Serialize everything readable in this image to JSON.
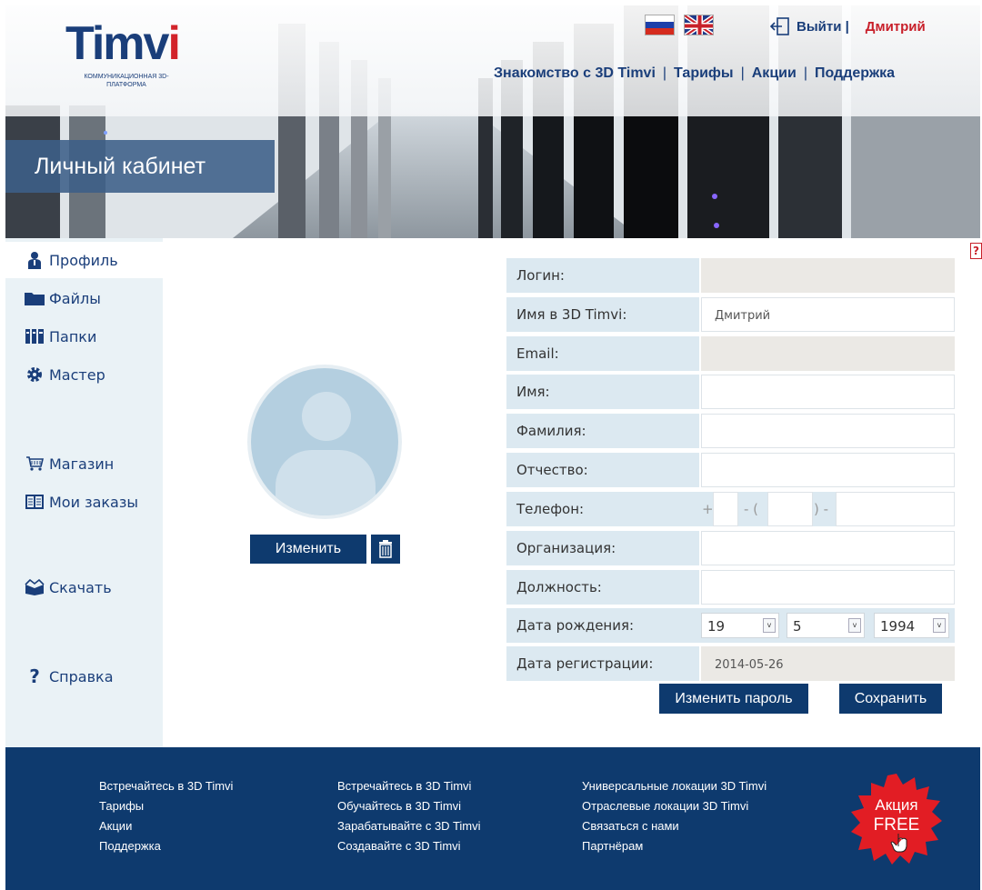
{
  "header": {
    "logo_text": "Timvi",
    "logo_subtitle": "КОММУНИКАЦИОННАЯ 3D-ПЛАТФОРМА",
    "logout_label": "Выйти |",
    "username": "Дмитрий",
    "nav": [
      {
        "label": "Знакомство с 3D Timvi"
      },
      {
        "label": "Тарифы"
      },
      {
        "label": "Акции"
      },
      {
        "label": "Поддержка"
      }
    ],
    "nav_separator": "|",
    "section_title": "Личный кабинет"
  },
  "sidebar": {
    "items": [
      {
        "label": "Профиль",
        "icon": "user-icon"
      },
      {
        "label": "Файлы",
        "icon": "folder-icon"
      },
      {
        "label": "Папки",
        "icon": "binders-icon"
      },
      {
        "label": "Мастер",
        "icon": "gear-icon"
      },
      {
        "label": "Магазин",
        "icon": "cart-icon"
      },
      {
        "label": "Мои заказы",
        "icon": "book-icon"
      },
      {
        "label": "Скачать",
        "icon": "download-box-icon"
      },
      {
        "label": "Справка",
        "icon": "question-icon"
      }
    ]
  },
  "help_icon": "?",
  "avatar": {
    "change_label": "Изменить"
  },
  "form": {
    "login": {
      "label": "Логин:",
      "value": ""
    },
    "display_name": {
      "label": "Имя в 3D Timvi:",
      "value": "Дмитрий"
    },
    "email": {
      "label": "Email:",
      "value": ""
    },
    "first_name": {
      "label": "Имя:",
      "value": ""
    },
    "last_name": {
      "label": "Фамилия:",
      "value": ""
    },
    "patronymic": {
      "label": "Отчество:",
      "value": ""
    },
    "phone": {
      "label": "Телефон:",
      "plus": "+",
      "dash_paren": "- (",
      "paren_dash": ") -"
    },
    "organization": {
      "label": "Организация:",
      "value": ""
    },
    "position": {
      "label": "Должность:",
      "value": ""
    },
    "birth_date": {
      "label": "Дата рождения:",
      "day": "19",
      "month": "5",
      "year": "1994",
      "arrow": "v"
    },
    "registration_date": {
      "label": "Дата регистрации:",
      "value": "2014-05-26"
    },
    "change_password_label": "Изменить пароль",
    "save_label": "Сохранить"
  },
  "footer": {
    "col1": [
      "Встречайтесь в 3D Timvi",
      "Тарифы",
      "Акции",
      "Поддержка"
    ],
    "col2": [
      "Встречайтесь в 3D Timvi",
      "Обучайтесь в 3D Timvi",
      "Зарабатывайте с 3D Timvi",
      "Создавайте с 3D Timvi"
    ],
    "col3": [
      "Универсальные локации 3D Timvi",
      "Отраслевые локации 3D Timvi",
      "Связаться с нами",
      "Партнёрам"
    ],
    "promo_line1": "Акция",
    "promo_line2": "FREE"
  },
  "colors": {
    "brand_blue": "#0e3a6e",
    "brand_red": "#c8202a",
    "label_bg": "#dce9f1",
    "sidebar_bg": "#eaf2f6"
  }
}
